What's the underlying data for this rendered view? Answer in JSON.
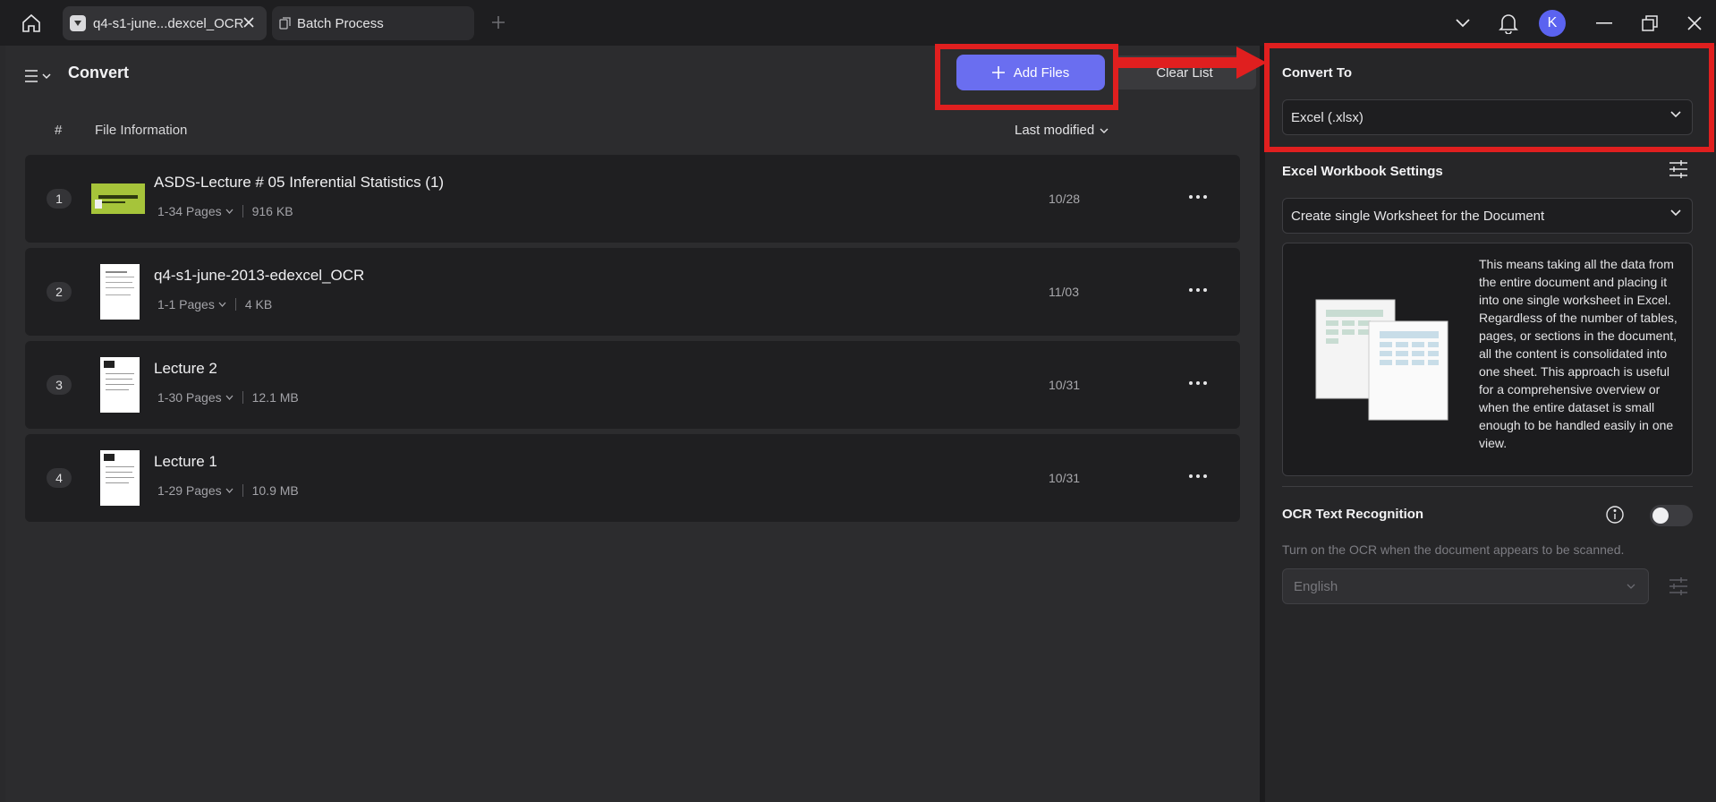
{
  "tabs": [
    {
      "label": "q4-s1-june...dexcel_OCR"
    },
    {
      "label": "Batch Process"
    }
  ],
  "avatar_initial": "K",
  "header": {
    "title": "Convert",
    "add_files": "Add Files",
    "clear_list": "Clear List"
  },
  "columns": {
    "hash": "#",
    "info": "File Information",
    "modified": "Last modified"
  },
  "files": [
    {
      "num": "1",
      "name": "ASDS-Lecture # 05 Inferential Statistics (1)",
      "pages": "1-34 Pages",
      "size": "916 KB",
      "date": "10/28"
    },
    {
      "num": "2",
      "name": "q4-s1-june-2013-edexcel_OCR",
      "pages": "1-1 Pages",
      "size": "4 KB",
      "date": "11/03"
    },
    {
      "num": "3",
      "name": "Lecture 2",
      "pages": "1-30 Pages",
      "size": "12.1 MB",
      "date": "10/31"
    },
    {
      "num": "4",
      "name": "Lecture 1",
      "pages": "1-29 Pages",
      "size": "10.9 MB",
      "date": "10/31"
    }
  ],
  "right_panel": {
    "convert_to_label": "Convert To",
    "convert_to_value": "Excel (.xlsx)",
    "workbook_label": "Excel Workbook Settings",
    "workbook_value": "Create single Worksheet for the Document",
    "description": "This means taking all the data from the entire document and placing it into one single worksheet in Excel. Regardless of the number of tables, pages, or sections in the document, all the content is consolidated into one sheet. This approach is useful for a comprehensive overview or when the entire dataset is small enough to be handled easily in one view.",
    "ocr_label": "OCR Text Recognition",
    "ocr_hint": "Turn on the OCR when the document appears to be scanned.",
    "ocr_language": "English",
    "ocr_enabled": false
  },
  "colors": {
    "accent": "#6a6ef0",
    "annotation": "#e01f1f"
  }
}
